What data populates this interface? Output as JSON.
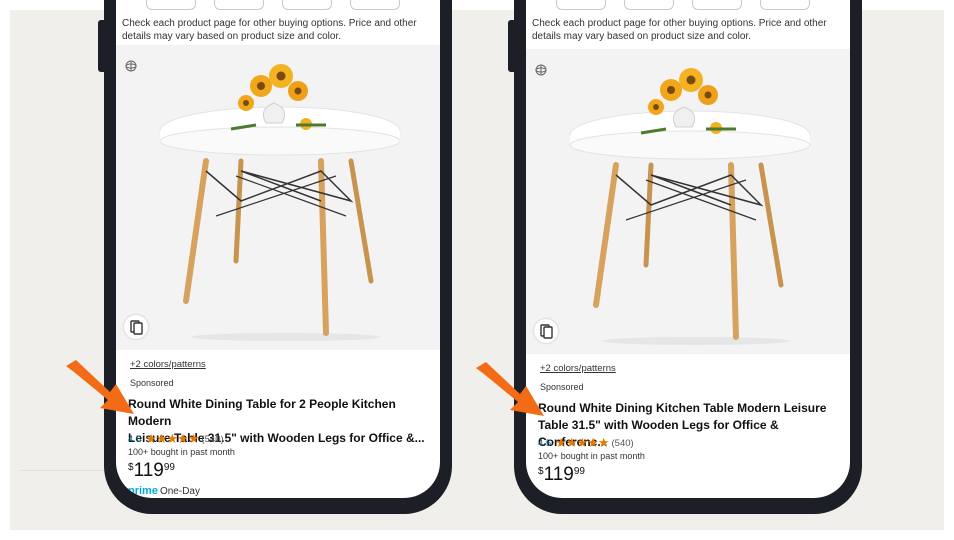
{
  "colors": {
    "accent_arrow": "#f26b16",
    "star": "#e67a00",
    "rating_link": "#0b6b85",
    "prime": "#00a8e1",
    "phone_frame": "#1c1f26"
  },
  "phones": [
    {
      "notice": "Check each product page for other buying options. Price and other details may vary based on product size and color.",
      "colors_link": "+2 colors/patterns",
      "sponsored": "Sponsored",
      "title_line1": "Round White Dining Table for 2 People Kitchen Modern",
      "title_line2": "Leisure Table 31.5\" with Wooden Legs for Office &...",
      "rating": "4.5",
      "stars": "★★★★★",
      "review_count": "(540)",
      "bought": "100+ bought in past month",
      "price_currency": "$",
      "price_whole": "119",
      "price_fraction": "99",
      "prime_label": "prime",
      "delivery_label": "One-Day"
    },
    {
      "notice": "Check each product page for other buying options. Price and other details may vary based on product size and color.",
      "colors_link": "+2 colors/patterns",
      "sponsored": "Sponsored",
      "title_line1": "Round White Dining Kitchen Table Modern Leisure",
      "title_line2": "Table 31.5\" with Wooden Legs for Office & Conferenc...",
      "rating": "4.5",
      "stars": "★★★★★",
      "review_count": "(540)",
      "bought": "100+ bought in past month",
      "price_currency": "$",
      "price_whole": "119",
      "price_fraction": "99"
    }
  ],
  "icons": {
    "view_360": "rotate-360-icon",
    "compare": "compare-icon",
    "arrow": "arrow-pointer-icon"
  }
}
